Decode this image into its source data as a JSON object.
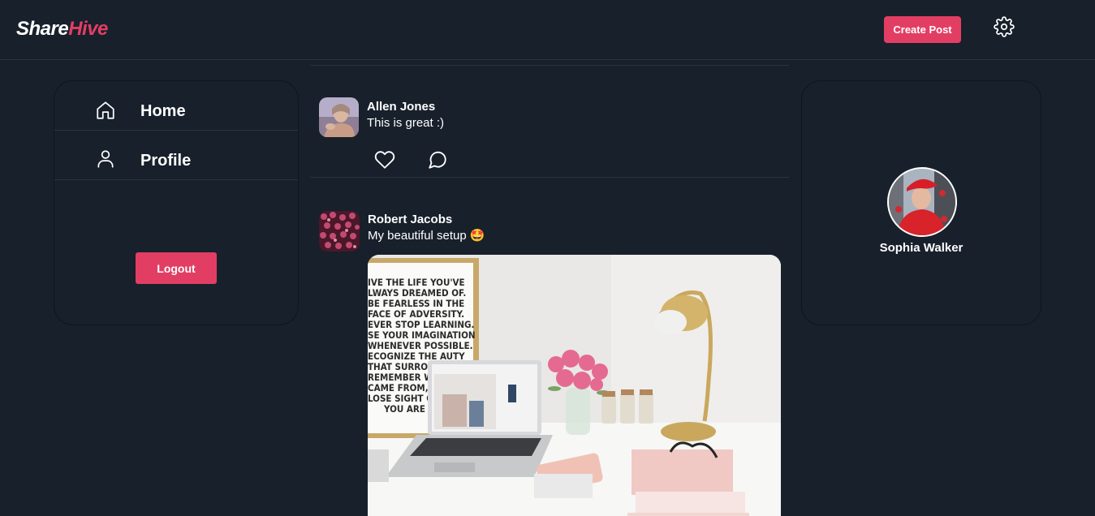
{
  "header": {
    "logo_part1": "Share",
    "logo_part2": "Hive",
    "create_post_label": "Create Post",
    "settings_icon": "gear-icon"
  },
  "sidebar": {
    "items": [
      {
        "label": "Home",
        "icon": "home-icon"
      },
      {
        "label": "Profile",
        "icon": "user-icon"
      }
    ],
    "logout_label": "Logout"
  },
  "feed": {
    "posts": [
      {
        "author": "Allen Jones",
        "text": "This is great :)",
        "actions": [
          "heart-icon",
          "comment-icon"
        ]
      },
      {
        "author": "Robert Jacobs",
        "text": "My beautiful setup 🤩",
        "has_image": true
      }
    ]
  },
  "profile": {
    "name": "Sophia Walker"
  },
  "poster": {
    "lines": [
      "IVE THE LIFE YOU'VE",
      "LWAYS DREAMED OF.",
      "BE FEARLESS IN THE",
      "FACE OF ADVERSITY.",
      "EVER STOP LEARNING.",
      "SE YOUR IMAGINATION",
      "WHENEVER POSSIBLE.",
      "ECOGNIZE THE    AUTY",
      "THAT SURROUN",
      "REMEMBER WHI",
      "CAME FROM, BUT",
      "LOSE SIGHT OF",
      "YOU ARE GO"
    ]
  },
  "colors": {
    "background": "#18202b",
    "accent": "#e23e63",
    "border": "#2a3340"
  }
}
